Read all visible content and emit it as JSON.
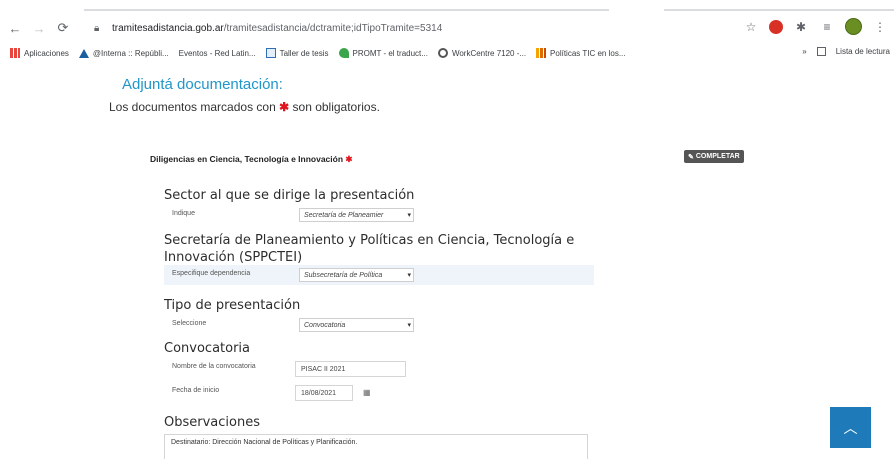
{
  "browser": {
    "url_domain": "tramitesadistancia.gob.ar",
    "url_path": "/tramitesadistancia/dctramite;idTipoTramite=5314",
    "bookmarks": [
      {
        "label": "Aplicaciones",
        "icon": "apps-grid-icon"
      },
      {
        "label": "@Interna :: Repúbli...",
        "icon": "triangle-icon"
      },
      {
        "label": "Eventos - Red Latin...",
        "icon": "doc-icon"
      },
      {
        "label": "Taller de tesis",
        "icon": "calendar-icon"
      },
      {
        "label": "PROMT - el traduct...",
        "icon": "promt-icon"
      },
      {
        "label": "WorkCentre 7120 -...",
        "icon": "printer-icon"
      },
      {
        "label": "Políticas TIC en los...",
        "icon": "chart-icon"
      }
    ],
    "bookmarks_overflow": "»",
    "reading_list": "Lista de lectura"
  },
  "page": {
    "heading": "Adjuntá documentación:",
    "subtitle_prefix": "Los documentos marcados con",
    "subtitle_suffix": "son obligatorios.",
    "required_mark": "✱"
  },
  "section": {
    "title": "Diligencias en Ciencia, Tecnología e Innovación",
    "completar_label": "COMPLETAR"
  },
  "form": {
    "sector_heading": "Sector al que se dirige la presentación",
    "indique_label": "Indique",
    "indique_value": "Secretaría de Planeamier",
    "secretaria_heading_line1": "Secretaría de Planeamiento y Políticas en Ciencia, Tecnología e",
    "secretaria_heading_line2": "Innovación (SPPCTEI)",
    "dependencia_label": "Especifique dependencia",
    "dependencia_value": "Subsecretaría de Política",
    "tipo_heading": "Tipo de presentación",
    "seleccione_label": "Seleccione",
    "seleccione_value": "Convocatoria",
    "convocatoria_heading": "Convocatoria",
    "nombre_label": "Nombre de la convocatoria",
    "nombre_value": "PISAC II 2021",
    "fecha_label": "Fecha de inicio",
    "fecha_value": "18/08/2021",
    "observaciones_heading": "Observaciones",
    "observaciones_value": "Destinatario: Dirección Nacional de Políticas y Planificación."
  },
  "colors": {
    "heading_blue": "#2196c9",
    "required_red": "#e0141e",
    "scroll_button": "#1e7ab8"
  }
}
